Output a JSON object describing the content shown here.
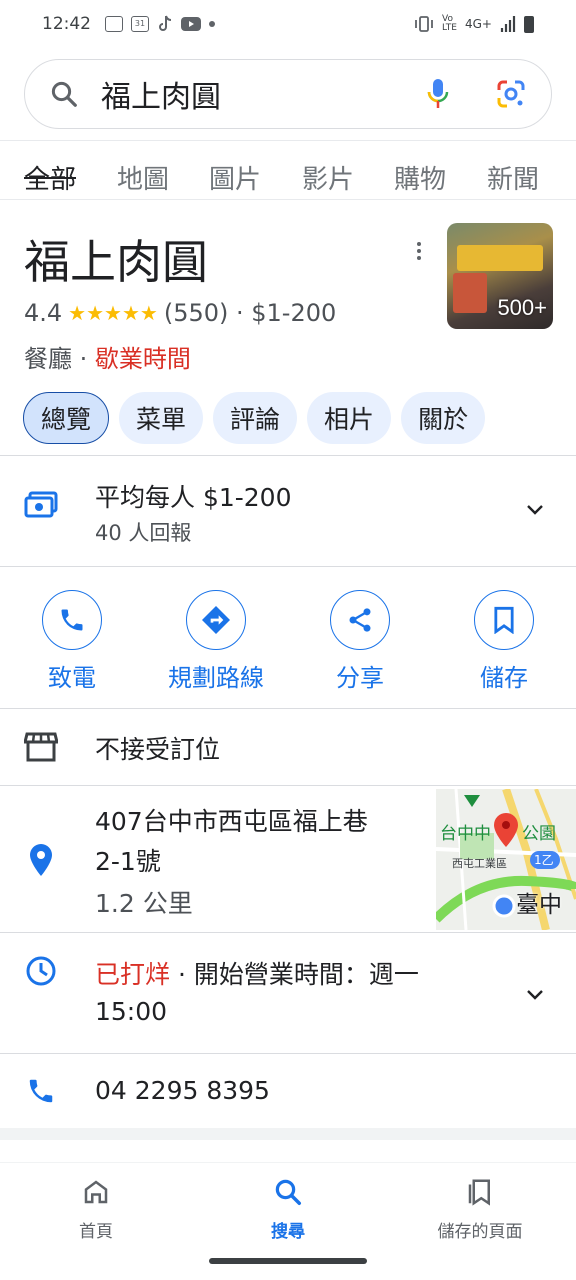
{
  "status_bar": {
    "time": "12:42",
    "network": "4G+"
  },
  "search": {
    "query": "福上肉圓"
  },
  "tabs": [
    {
      "label": "全部",
      "active": true
    },
    {
      "label": "地圖"
    },
    {
      "label": "圖片"
    },
    {
      "label": "影片"
    },
    {
      "label": "購物"
    },
    {
      "label": "新聞"
    }
  ],
  "place": {
    "name": "福上肉圓",
    "rating": "4.4",
    "stars": "★★★★★",
    "review_count": "(550)",
    "price": "$1-200",
    "category": "餐廳",
    "hours_status": "歇業時間",
    "photo_count": "500+"
  },
  "chips": [
    {
      "label": "總覽",
      "active": true
    },
    {
      "label": "菜單"
    },
    {
      "label": "評論"
    },
    {
      "label": "相片"
    },
    {
      "label": "關於"
    }
  ],
  "price_info": {
    "label": "平均每人 $1-200",
    "sub": "40 人回報"
  },
  "actions": [
    {
      "label": "致電",
      "icon": "phone-icon"
    },
    {
      "label": "規劃路線",
      "icon": "directions-icon"
    },
    {
      "label": "分享",
      "icon": "share-icon"
    },
    {
      "label": "儲存",
      "icon": "bookmark-icon"
    }
  ],
  "reservation": {
    "label": "不接受訂位"
  },
  "address": {
    "line1": "407台中市西屯區福上巷",
    "line2": "2-1號",
    "distance": "1.2 公里"
  },
  "map_labels": {
    "park": "台中中",
    "park2": "公園",
    "industrial": "西屯工業區",
    "route": "1乙",
    "city": "臺中"
  },
  "hours": {
    "status": "已打烊",
    "separator": " · ",
    "opening": "開始營業時間：週一",
    "time": "15:00"
  },
  "phone": {
    "number": "04 2295 8395"
  },
  "bottom_nav": [
    {
      "label": "首頁",
      "icon": "home-icon"
    },
    {
      "label": "搜尋",
      "icon": "search-icon",
      "active": true
    },
    {
      "label": "儲存的頁面",
      "icon": "saved-pages-icon"
    }
  ],
  "colors": {
    "accent": "#1a73e8",
    "closed": "#d93025",
    "star": "#fbbc04",
    "chip_bg": "#e8f0fe"
  }
}
